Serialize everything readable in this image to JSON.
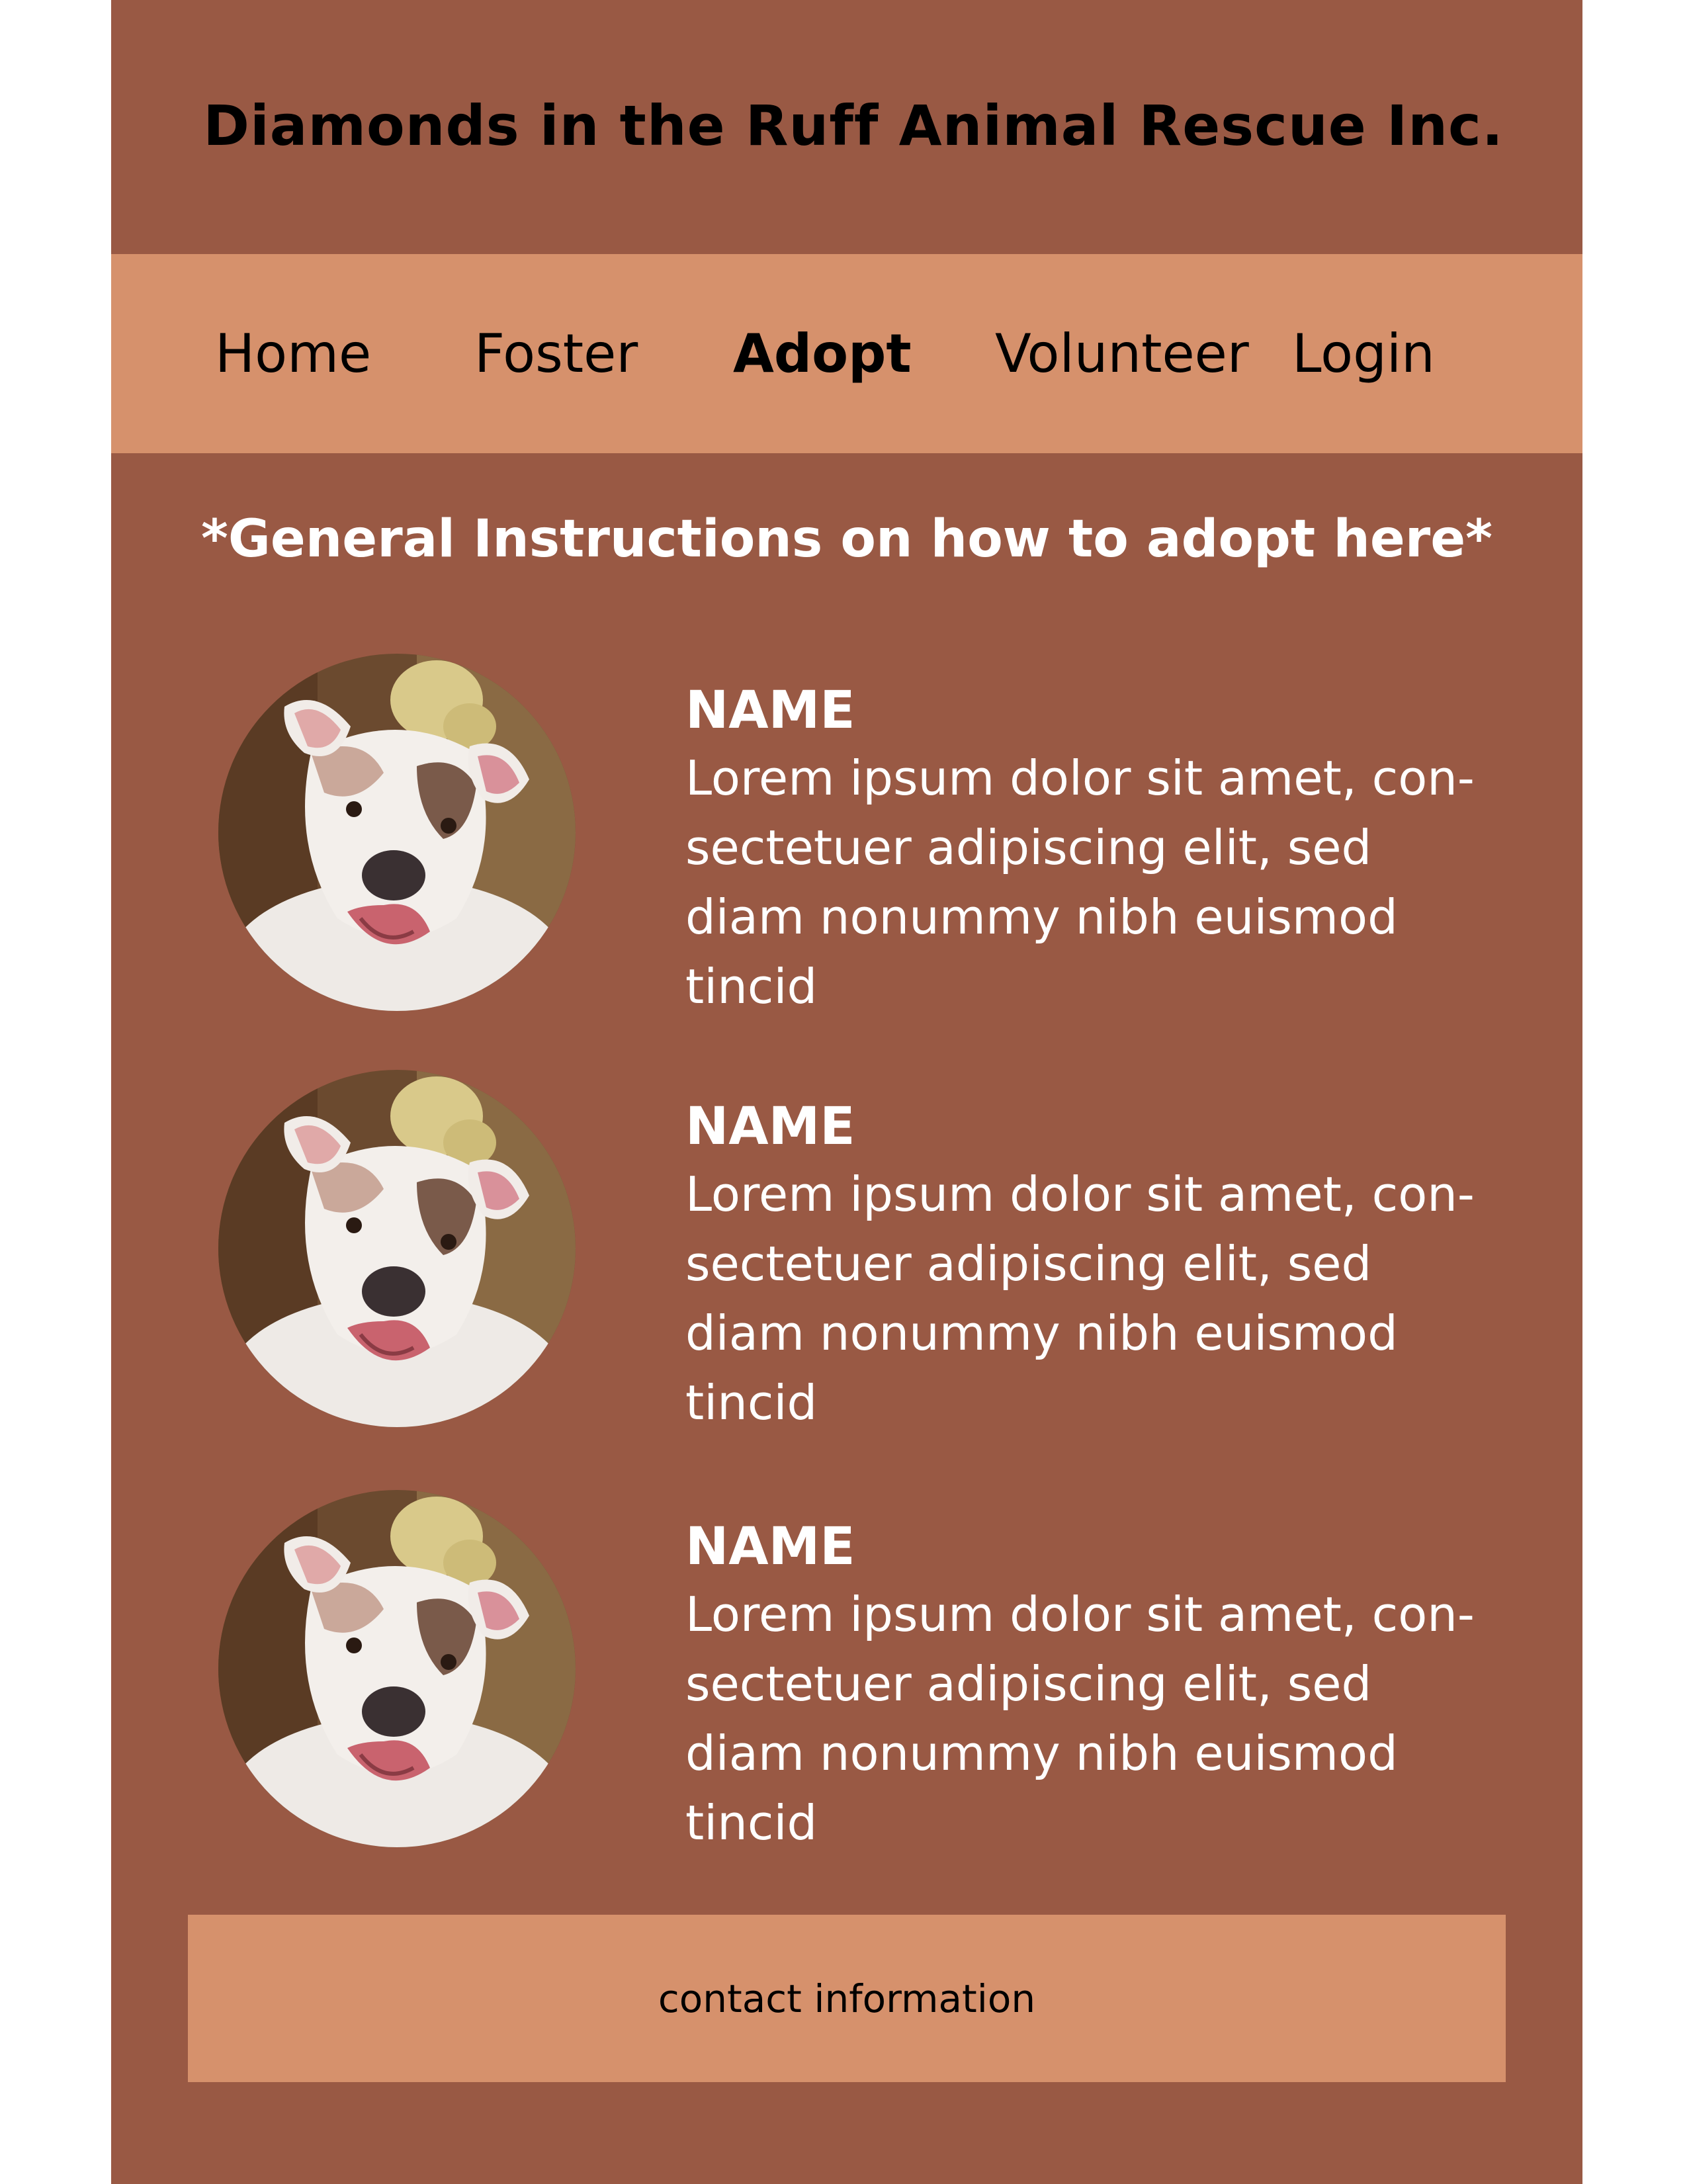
{
  "site": {
    "title": "Diamonds in the Ruff Animal Rescue Inc."
  },
  "nav": {
    "items": [
      {
        "label": "Home",
        "active": false
      },
      {
        "label": "Foster",
        "active": false
      },
      {
        "label": "Adopt",
        "active": true
      },
      {
        "label": "Volunteer",
        "active": false
      },
      {
        "label": "Login",
        "active": false
      }
    ]
  },
  "main": {
    "instructions": "*General Instructions on how to adopt here*",
    "pets": [
      {
        "name": "NAME",
        "description": "Lorem ipsum dolor sit amet, con-\nsectetuer adipiscing elit, sed\ndiam nonummy nibh euismod\ntincid",
        "photo_icon": "dog-photo"
      },
      {
        "name": "NAME",
        "description": "Lorem ipsum dolor sit amet, con-\nsectetuer adipiscing elit, sed\ndiam nonummy nibh euismod\ntincid",
        "photo_icon": "dog-photo"
      },
      {
        "name": "NAME",
        "description": "Lorem ipsum dolor sit amet, con-\nsectetuer adipiscing elit, sed\ndiam nonummy nibh euismod\ntincid",
        "photo_icon": "dog-photo"
      }
    ]
  },
  "footer": {
    "contact": "contact information"
  },
  "colors": {
    "page_background": "#995944",
    "nav_background": "#d6916c",
    "footer_background": "#d6916c",
    "body_text": "#ffffff",
    "header_text": "#000000"
  }
}
